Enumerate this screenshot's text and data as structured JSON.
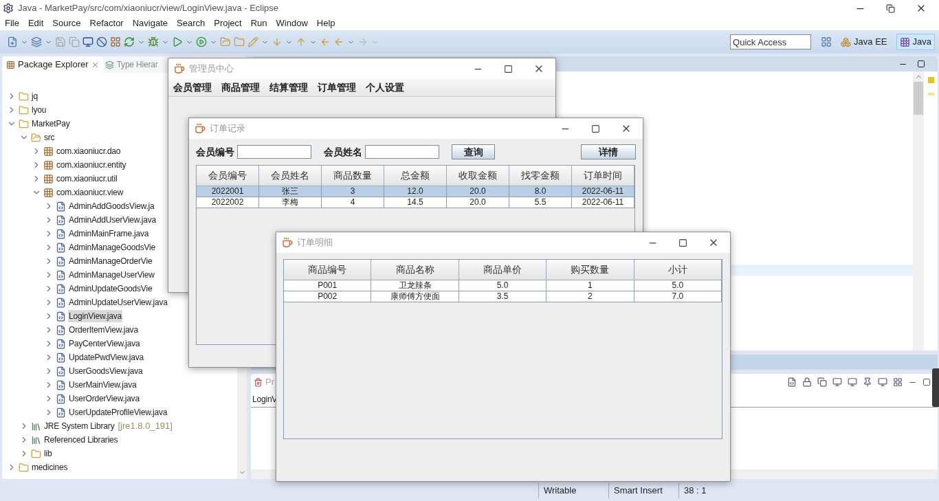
{
  "ide": {
    "title": "Java - MarketPay/src/com/xiaoniucr/view/LoginView.java - Eclipse",
    "menu": [
      "File",
      "Edit",
      "Source",
      "Refactor",
      "Navigate",
      "Search",
      "Project",
      "Run",
      "Window",
      "Help"
    ],
    "quick_access": {
      "placeholder": "Quick Access"
    },
    "perspectives": [
      {
        "label": "Java EE",
        "selected": false
      },
      {
        "label": "Java",
        "selected": true
      }
    ],
    "package_explorer": {
      "tabs": [
        {
          "label": "Package Explorer",
          "selected": true
        },
        {
          "label": "Type Hierar",
          "selected": false
        }
      ],
      "tree": [
        {
          "label": "jq",
          "kind": "project",
          "expanded": false,
          "selected": false
        },
        {
          "label": "lyou",
          "kind": "project",
          "expanded": false,
          "selected": false
        },
        {
          "label": "MarketPay",
          "kind": "project",
          "expanded": true,
          "selected": false,
          "children": [
            {
              "label": "src",
              "kind": "source",
              "expanded": true,
              "selected": false,
              "children": [
                {
                  "label": "com.xiaoniucr.dao",
                  "kind": "package",
                  "expanded": false,
                  "selected": false
                },
                {
                  "label": "com.xiaoniucr.entity",
                  "kind": "package",
                  "expanded": false,
                  "selected": false
                },
                {
                  "label": "com.xiaoniucr.util",
                  "kind": "package",
                  "expanded": false,
                  "selected": false
                },
                {
                  "label": "com.xiaoniucr.view",
                  "kind": "package",
                  "expanded": true,
                  "selected": false,
                  "children": [
                    {
                      "label": "AdminAddGoodsView.ja",
                      "kind": "file",
                      "expanded": false,
                      "selected": false
                    },
                    {
                      "label": "AdminAddUserView.java",
                      "kind": "file",
                      "expanded": false,
                      "selected": false
                    },
                    {
                      "label": "AdminMainFrame.java",
                      "kind": "file",
                      "expanded": false,
                      "selected": false
                    },
                    {
                      "label": "AdminManageGoodsVie",
                      "kind": "file",
                      "expanded": false,
                      "selected": false
                    },
                    {
                      "label": "AdminManageOrderVie",
                      "kind": "file",
                      "expanded": false,
                      "selected": false
                    },
                    {
                      "label": "AdminManageUserView",
                      "kind": "file",
                      "expanded": false,
                      "selected": false
                    },
                    {
                      "label": "AdminUpdateGoodsVie",
                      "kind": "file",
                      "expanded": false,
                      "selected": false
                    },
                    {
                      "label": "AdminUpdateUserView.java",
                      "kind": "file",
                      "expanded": false,
                      "selected": false
                    },
                    {
                      "label": "LoginView.java",
                      "kind": "file",
                      "expanded": false,
                      "selected": true
                    },
                    {
                      "label": "OrderItemView.java",
                      "kind": "file",
                      "expanded": false,
                      "selected": false
                    },
                    {
                      "label": "PayCenterView.java",
                      "kind": "file",
                      "expanded": false,
                      "selected": false
                    },
                    {
                      "label": "UpdatePwdView.java",
                      "kind": "file",
                      "expanded": false,
                      "selected": false
                    },
                    {
                      "label": "UserGoodsView.java",
                      "kind": "file",
                      "expanded": false,
                      "selected": false
                    },
                    {
                      "label": "UserMainView.java",
                      "kind": "file",
                      "expanded": false,
                      "selected": false
                    },
                    {
                      "label": "UserOrderView.java",
                      "kind": "file",
                      "expanded": false,
                      "selected": false
                    },
                    {
                      "label": "UserUpdateProfileView.java",
                      "kind": "file",
                      "expanded": false,
                      "selected": false
                    }
                  ]
                }
              ]
            },
            {
              "label": "JRE System Library",
              "suffix": "[jre1.8.0_191]",
              "kind": "library",
              "expanded": false,
              "selected": false
            },
            {
              "label": "Referenced Libraries",
              "kind": "library",
              "expanded": false,
              "selected": false
            },
            {
              "label": "lib",
              "kind": "folder",
              "expanded": false,
              "selected": false
            }
          ]
        },
        {
          "label": "medicines",
          "kind": "project",
          "expanded": false,
          "selected": false
        }
      ]
    },
    "bottom_panel": {
      "tab": "Pr",
      "line": "LoginV"
    },
    "status_bar": [
      "Writable",
      "Smart Insert",
      "38 : 1"
    ]
  },
  "windows": [
    {
      "title": "管理员中心",
      "menu": [
        "会员管理",
        "商品管理",
        "结算管理",
        "订单管理",
        "个人设置"
      ]
    },
    {
      "title": "订单记录",
      "fields": [
        {
          "label": "会员编号"
        },
        {
          "label": "会员姓名"
        }
      ],
      "buttons": [
        "查询",
        "详情"
      ],
      "table": {
        "columns": [
          "会员编号",
          "会员姓名",
          "商品数量",
          "总金额",
          "收取金额",
          "找零金额",
          "订单时间"
        ],
        "rows": [
          {
            "cells": [
              "2022001",
              "张三",
              "3",
              "12.0",
              "20.0",
              "8.0",
              "2022-06-11"
            ],
            "selected": true
          },
          {
            "cells": [
              "2022002",
              "李梅",
              "4",
              "14.5",
              "20.0",
              "5.5",
              "2022-06-11"
            ],
            "selected": false
          }
        ]
      }
    },
    {
      "title": "订单明细",
      "table": {
        "columns": [
          "商品编号",
          "商品名称",
          "商品单价",
          "购买数量",
          "小计"
        ],
        "rows": [
          {
            "cells": [
              "P001",
              "卫龙辣条",
              "5.0",
              "1",
              "5.0"
            ],
            "selected": false
          },
          {
            "cells": [
              "P002",
              "康师傅方便面",
              "3.5",
              "2",
              "7.0"
            ],
            "selected": false
          }
        ]
      }
    }
  ]
}
